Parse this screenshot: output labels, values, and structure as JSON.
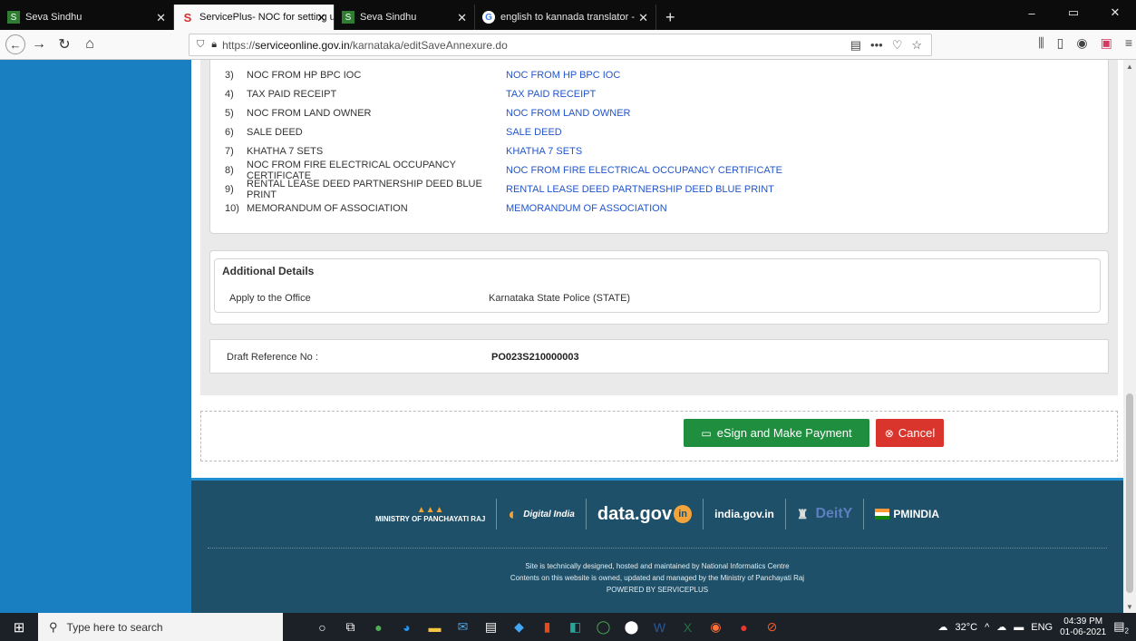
{
  "browser": {
    "tabs": [
      {
        "label": "Seva Sindhu",
        "active": false,
        "icon": "seva-favicon"
      },
      {
        "label": "ServicePlus- NOC for setting u",
        "active": true,
        "icon": "serviceplus-favicon"
      },
      {
        "label": "Seva Sindhu",
        "active": false,
        "icon": "seva-favicon"
      },
      {
        "label": "english to kannada translator -",
        "active": false,
        "icon": "google-favicon"
      }
    ],
    "url_prefix": "https://",
    "url_host": "serviceonline.gov.in",
    "url_path": "/karnataka/editSaveAnnexure.do"
  },
  "documents": [
    {
      "num": "3)",
      "name": "NOC FROM HP BPC IOC",
      "link": "NOC FROM HP BPC IOC"
    },
    {
      "num": "4)",
      "name": "TAX PAID RECEIPT",
      "link": "TAX PAID RECEIPT"
    },
    {
      "num": "5)",
      "name": "NOC FROM LAND OWNER",
      "link": "NOC FROM LAND OWNER"
    },
    {
      "num": "6)",
      "name": "SALE DEED",
      "link": "SALE DEED"
    },
    {
      "num": "7)",
      "name": "KHATHA 7 SETS",
      "link": "KHATHA 7 SETS"
    },
    {
      "num": "8)",
      "name": "NOC FROM FIRE ELECTRICAL OCCUPANCY CERTIFICATE",
      "link": "NOC FROM FIRE ELECTRICAL OCCUPANCY CERTIFICATE"
    },
    {
      "num": "9)",
      "name": "RENTAL LEASE DEED PARTNERSHIP DEED BLUE PRINT",
      "link": "RENTAL LEASE DEED PARTNERSHIP DEED BLUE PRINT"
    },
    {
      "num": "10)",
      "name": "MEMORANDUM OF ASSOCIATION",
      "link": "MEMORANDUM OF ASSOCIATION"
    }
  ],
  "additional": {
    "title": "Additional Details",
    "label": "Apply to the Office",
    "value": "Karnataka State Police (STATE)"
  },
  "draft": {
    "label": "Draft Reference No :",
    "value": "PO023S210000003"
  },
  "actions": {
    "esign_label": "eSign and Make Payment",
    "cancel_label": "Cancel"
  },
  "footer": {
    "logos": [
      "MINISTRY OF PANCHAYATI RAJ",
      "Digital India",
      "data.gov",
      "india.gov.in",
      "DeitY",
      "PMINDIA"
    ],
    "line1": "Site is technically designed, hosted and maintained by National Informatics Centre",
    "line2": "Contents on this website is owned, updated and managed by the Ministry of Panchayati Raj",
    "line3": "POWERED BY SERVICEPLUS"
  },
  "taskbar": {
    "search_placeholder": "Type here to search",
    "temperature": "32°C",
    "lang": "ENG",
    "time": "04:39 PM",
    "date": "01-06-2021",
    "notif_count": "2"
  }
}
